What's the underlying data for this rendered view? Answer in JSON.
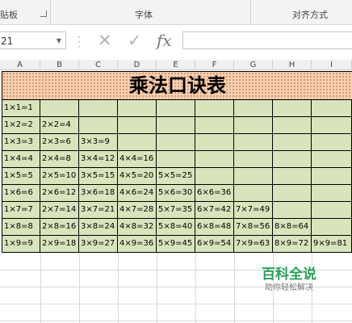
{
  "ribbon": {
    "groups": [
      "剪贴板",
      "字体",
      "对齐方式"
    ],
    "clipboard_visible": "贴板"
  },
  "formula_bar": {
    "name_box": "21",
    "fx": "fx",
    "value": ""
  },
  "columns": [
    "A",
    "B",
    "C",
    "D",
    "E",
    "F",
    "G",
    "H",
    "I"
  ],
  "sheet": {
    "title": "乘法口诀表",
    "rows": [
      [
        "1×1=1"
      ],
      [
        "1×2=2",
        "2×2=4"
      ],
      [
        "1×3=3",
        "2×3=6",
        "3×3=9"
      ],
      [
        "1×4=4",
        "2×4=8",
        "3×4=12",
        "4×4=16"
      ],
      [
        "1×5=5",
        "2×5=10",
        "3×5=15",
        "4×5=20",
        "5×5=25"
      ],
      [
        "1×6=6",
        "2×6=12",
        "3×6=18",
        "4×6=24",
        "5×6=30",
        "6×6=36"
      ],
      [
        "1×7=7",
        "2×7=14",
        "3×7=21",
        "4×7=28",
        "5×7=35",
        "6×7=42",
        "7×7=49"
      ],
      [
        "1×8=8",
        "2×8=16",
        "3×8=24",
        "4×8=32",
        "5×8=40",
        "6×8=48",
        "7×8=56",
        "8×8=64"
      ],
      [
        "1×9=9",
        "2×9=18",
        "3×9=27",
        "4×9=36",
        "5×9=45",
        "6×9=54",
        "7×9=63",
        "8×9=72",
        "9×9=81"
      ]
    ]
  },
  "watermark": {
    "title": "百科全说",
    "subtitle": "助你轻松解决"
  }
}
